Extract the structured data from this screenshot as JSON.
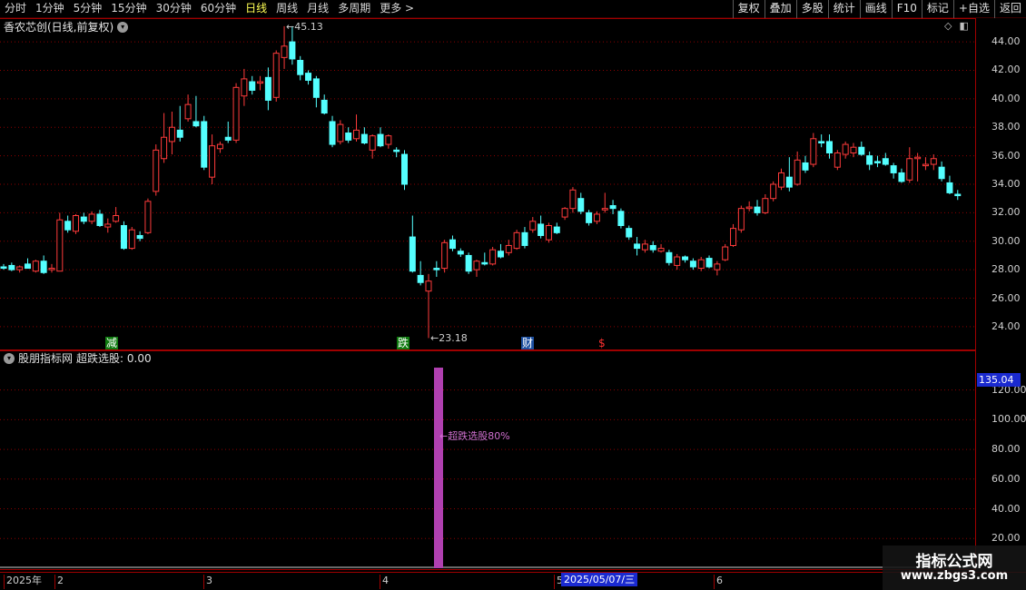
{
  "toolbar": {
    "periods": [
      "分时",
      "1分钟",
      "5分钟",
      "15分钟",
      "30分钟",
      "60分钟",
      "日线",
      "周线",
      "月线",
      "多周期",
      "更多 >"
    ],
    "active_period": "日线",
    "buttons": [
      "复权",
      "叠加",
      "多股",
      "统计",
      "画线",
      "F10",
      "标记",
      "+自选",
      "返回"
    ]
  },
  "main_panel": {
    "title": "香农芯创(日线,前复权)",
    "high_label": "45.13",
    "low_label": "23.18",
    "y_axis_ticks": [
      "44.00",
      "42.00",
      "40.00",
      "38.00",
      "36.00",
      "34.00",
      "32.00",
      "30.00",
      "28.00",
      "26.00",
      "24.00"
    ],
    "markers": [
      {
        "text": "减",
        "color": "#ffffff",
        "bg": "#0f7a0f"
      },
      {
        "text": "跌",
        "color": "#ffffff",
        "bg": "#0f7a0f"
      },
      {
        "text": "财",
        "color": "#ffffff",
        "bg": "#1c4fa0"
      },
      {
        "text": "$",
        "color": "#ff3030",
        "bg": "transparent"
      }
    ]
  },
  "indicator_panel": {
    "title": "股朋指标网",
    "formula_label": "超跌选股: 0.00",
    "bar_label": "超跌选股80%",
    "current_value": "135.04",
    "y_axis_ticks": [
      "120.00",
      "100.00",
      "80.00",
      "60.00",
      "40.00",
      "20.00"
    ],
    "bar_value": 135.04,
    "bar_color": "#b040b0"
  },
  "date_axis": {
    "ticks": [
      "2025年",
      "2",
      "3",
      "4",
      "5",
      "6"
    ],
    "cursor_date": "2025/05/07/三"
  },
  "watermark": {
    "title": "指标公式网",
    "url": "www.zbgs3.com"
  },
  "colors": {
    "up": "#ff3b3b",
    "down": "#54ffff",
    "grid": "#8a0000",
    "frame": "#a00000"
  },
  "chart_data": {
    "type": "candlestick",
    "ylim": [
      22.4,
      45.6
    ],
    "candles": [
      {
        "o": 28.2,
        "h": 28.4,
        "l": 28.0,
        "c": 28.1
      },
      {
        "o": 28.3,
        "h": 28.5,
        "l": 27.9,
        "c": 28.0
      },
      {
        "o": 28.0,
        "h": 28.3,
        "l": 27.8,
        "c": 28.2
      },
      {
        "o": 28.4,
        "h": 28.8,
        "l": 28.2,
        "c": 28.1
      },
      {
        "o": 27.9,
        "h": 28.7,
        "l": 27.8,
        "c": 28.6
      },
      {
        "o": 28.6,
        "h": 29.0,
        "l": 27.7,
        "c": 27.8
      },
      {
        "o": 28.0,
        "h": 28.4,
        "l": 27.8,
        "c": 28.1
      },
      {
        "o": 27.9,
        "h": 32.0,
        "l": 27.9,
        "c": 31.5
      },
      {
        "o": 31.4,
        "h": 31.8,
        "l": 30.6,
        "c": 30.8
      },
      {
        "o": 30.7,
        "h": 31.9,
        "l": 30.5,
        "c": 31.8
      },
      {
        "o": 31.7,
        "h": 32.0,
        "l": 31.2,
        "c": 31.4
      },
      {
        "o": 31.4,
        "h": 32.1,
        "l": 31.2,
        "c": 31.9
      },
      {
        "o": 31.9,
        "h": 32.2,
        "l": 31.0,
        "c": 31.1
      },
      {
        "o": 31.0,
        "h": 31.6,
        "l": 30.6,
        "c": 31.2
      },
      {
        "o": 31.4,
        "h": 32.4,
        "l": 31.3,
        "c": 31.8
      },
      {
        "o": 31.1,
        "h": 31.4,
        "l": 29.4,
        "c": 29.5
      },
      {
        "o": 29.5,
        "h": 31.0,
        "l": 29.4,
        "c": 30.8
      },
      {
        "o": 30.4,
        "h": 30.7,
        "l": 30.0,
        "c": 30.2
      },
      {
        "o": 30.6,
        "h": 33.0,
        "l": 30.5,
        "c": 32.8
      },
      {
        "o": 33.5,
        "h": 36.8,
        "l": 33.2,
        "c": 36.4
      },
      {
        "o": 35.8,
        "h": 39.0,
        "l": 35.5,
        "c": 37.3
      },
      {
        "o": 37.0,
        "h": 39.1,
        "l": 36.1,
        "c": 38.0
      },
      {
        "o": 37.8,
        "h": 39.5,
        "l": 37.0,
        "c": 37.3
      },
      {
        "o": 38.6,
        "h": 40.3,
        "l": 38.4,
        "c": 39.6
      },
      {
        "o": 38.4,
        "h": 40.2,
        "l": 38.0,
        "c": 38.1
      },
      {
        "o": 38.4,
        "h": 38.8,
        "l": 35.0,
        "c": 35.2
      },
      {
        "o": 34.5,
        "h": 37.5,
        "l": 34.0,
        "c": 36.7
      },
      {
        "o": 36.5,
        "h": 37.0,
        "l": 36.2,
        "c": 36.8
      },
      {
        "o": 37.3,
        "h": 38.4,
        "l": 36.9,
        "c": 37.1
      },
      {
        "o": 37.1,
        "h": 41.1,
        "l": 36.9,
        "c": 40.8
      },
      {
        "o": 40.2,
        "h": 42.1,
        "l": 39.5,
        "c": 41.4
      },
      {
        "o": 41.2,
        "h": 41.6,
        "l": 40.3,
        "c": 40.6
      },
      {
        "o": 41.1,
        "h": 41.6,
        "l": 40.6,
        "c": 41.2
      },
      {
        "o": 41.5,
        "h": 42.2,
        "l": 39.2,
        "c": 39.9
      },
      {
        "o": 40.1,
        "h": 43.4,
        "l": 39.8,
        "c": 43.2
      },
      {
        "o": 42.9,
        "h": 45.1,
        "l": 42.1,
        "c": 43.7
      },
      {
        "o": 44.0,
        "h": 45.1,
        "l": 42.4,
        "c": 42.8
      },
      {
        "o": 42.7,
        "h": 43.0,
        "l": 41.3,
        "c": 41.7
      },
      {
        "o": 41.8,
        "h": 42.0,
        "l": 41.0,
        "c": 41.3
      },
      {
        "o": 41.4,
        "h": 41.6,
        "l": 39.4,
        "c": 40.1
      },
      {
        "o": 39.9,
        "h": 40.3,
        "l": 38.9,
        "c": 39.0
      },
      {
        "o": 38.4,
        "h": 38.8,
        "l": 36.6,
        "c": 36.8
      },
      {
        "o": 37.0,
        "h": 38.5,
        "l": 36.8,
        "c": 38.2
      },
      {
        "o": 37.6,
        "h": 38.0,
        "l": 36.9,
        "c": 37.1
      },
      {
        "o": 37.2,
        "h": 38.9,
        "l": 37.0,
        "c": 37.8
      },
      {
        "o": 37.5,
        "h": 38.0,
        "l": 36.8,
        "c": 36.9
      },
      {
        "o": 36.4,
        "h": 37.5,
        "l": 35.8,
        "c": 37.4
      },
      {
        "o": 37.5,
        "h": 38.0,
        "l": 36.6,
        "c": 36.7
      },
      {
        "o": 36.8,
        "h": 37.5,
        "l": 36.5,
        "c": 37.4
      },
      {
        "o": 36.4,
        "h": 36.6,
        "l": 35.9,
        "c": 36.3
      },
      {
        "o": 36.1,
        "h": 36.4,
        "l": 33.6,
        "c": 34.0
      },
      {
        "o": 30.3,
        "h": 31.8,
        "l": 27.8,
        "c": 27.9
      },
      {
        "o": 27.6,
        "h": 28.6,
        "l": 26.9,
        "c": 27.1
      },
      {
        "o": 26.5,
        "h": 27.7,
        "l": 23.2,
        "c": 27.2
      },
      {
        "o": 28.1,
        "h": 28.6,
        "l": 27.5,
        "c": 28.0
      },
      {
        "o": 28.1,
        "h": 30.1,
        "l": 27.8,
        "c": 29.9
      },
      {
        "o": 30.1,
        "h": 30.4,
        "l": 29.3,
        "c": 29.5
      },
      {
        "o": 29.3,
        "h": 29.5,
        "l": 28.9,
        "c": 29.1
      },
      {
        "o": 29.0,
        "h": 29.2,
        "l": 27.7,
        "c": 27.9
      },
      {
        "o": 28.0,
        "h": 28.7,
        "l": 27.5,
        "c": 28.6
      },
      {
        "o": 28.5,
        "h": 29.2,
        "l": 28.3,
        "c": 28.4
      },
      {
        "o": 28.4,
        "h": 29.6,
        "l": 28.3,
        "c": 29.4
      },
      {
        "o": 29.3,
        "h": 29.8,
        "l": 28.8,
        "c": 28.9
      },
      {
        "o": 29.2,
        "h": 30.1,
        "l": 29.0,
        "c": 29.7
      },
      {
        "o": 29.5,
        "h": 30.8,
        "l": 29.4,
        "c": 30.6
      },
      {
        "o": 30.6,
        "h": 31.0,
        "l": 29.5,
        "c": 29.7
      },
      {
        "o": 30.8,
        "h": 31.7,
        "l": 30.6,
        "c": 31.4
      },
      {
        "o": 31.2,
        "h": 31.8,
        "l": 30.2,
        "c": 30.4
      },
      {
        "o": 30.1,
        "h": 31.3,
        "l": 29.9,
        "c": 31.1
      },
      {
        "o": 31.0,
        "h": 31.3,
        "l": 30.5,
        "c": 30.6
      },
      {
        "o": 31.7,
        "h": 32.4,
        "l": 31.5,
        "c": 32.3
      },
      {
        "o": 32.3,
        "h": 33.8,
        "l": 32.0,
        "c": 33.6
      },
      {
        "o": 33.0,
        "h": 33.4,
        "l": 31.9,
        "c": 32.1
      },
      {
        "o": 32.0,
        "h": 32.2,
        "l": 31.1,
        "c": 31.3
      },
      {
        "o": 31.4,
        "h": 32.1,
        "l": 31.2,
        "c": 31.9
      },
      {
        "o": 32.2,
        "h": 33.4,
        "l": 32.0,
        "c": 32.3
      },
      {
        "o": 32.5,
        "h": 32.9,
        "l": 31.9,
        "c": 32.3
      },
      {
        "o": 32.1,
        "h": 32.3,
        "l": 30.9,
        "c": 31.1
      },
      {
        "o": 30.9,
        "h": 31.1,
        "l": 30.1,
        "c": 30.3
      },
      {
        "o": 29.8,
        "h": 30.3,
        "l": 29.0,
        "c": 29.5
      },
      {
        "o": 29.4,
        "h": 30.1,
        "l": 29.2,
        "c": 29.8
      },
      {
        "o": 29.7,
        "h": 30.0,
        "l": 29.2,
        "c": 29.4
      },
      {
        "o": 29.3,
        "h": 29.8,
        "l": 29.2,
        "c": 29.5
      },
      {
        "o": 29.2,
        "h": 29.4,
        "l": 28.3,
        "c": 28.5
      },
      {
        "o": 28.3,
        "h": 29.1,
        "l": 28.0,
        "c": 28.9
      },
      {
        "o": 28.9,
        "h": 29.0,
        "l": 28.5,
        "c": 28.7
      },
      {
        "o": 28.6,
        "h": 28.8,
        "l": 28.0,
        "c": 28.2
      },
      {
        "o": 28.1,
        "h": 28.9,
        "l": 27.9,
        "c": 28.7
      },
      {
        "o": 28.8,
        "h": 29.0,
        "l": 28.1,
        "c": 28.2
      },
      {
        "o": 28.0,
        "h": 28.6,
        "l": 27.6,
        "c": 28.4
      },
      {
        "o": 28.7,
        "h": 29.8,
        "l": 28.6,
        "c": 29.6
      },
      {
        "o": 29.7,
        "h": 31.2,
        "l": 29.6,
        "c": 30.9
      },
      {
        "o": 30.8,
        "h": 32.5,
        "l": 30.6,
        "c": 32.3
      },
      {
        "o": 32.3,
        "h": 32.8,
        "l": 32.1,
        "c": 32.4
      },
      {
        "o": 32.4,
        "h": 32.9,
        "l": 31.8,
        "c": 32.0
      },
      {
        "o": 32.0,
        "h": 33.3,
        "l": 31.9,
        "c": 33.0
      },
      {
        "o": 33.0,
        "h": 34.2,
        "l": 32.8,
        "c": 34.0
      },
      {
        "o": 33.8,
        "h": 35.1,
        "l": 33.6,
        "c": 34.8
      },
      {
        "o": 34.5,
        "h": 35.9,
        "l": 33.5,
        "c": 33.8
      },
      {
        "o": 34.0,
        "h": 36.3,
        "l": 33.9,
        "c": 35.7
      },
      {
        "o": 35.5,
        "h": 36.0,
        "l": 34.8,
        "c": 35.0
      },
      {
        "o": 35.4,
        "h": 37.6,
        "l": 35.2,
        "c": 37.2
      },
      {
        "o": 37.0,
        "h": 37.5,
        "l": 36.6,
        "c": 36.9
      },
      {
        "o": 37.0,
        "h": 37.5,
        "l": 35.8,
        "c": 36.2
      },
      {
        "o": 35.2,
        "h": 36.4,
        "l": 35.0,
        "c": 36.2
      },
      {
        "o": 36.1,
        "h": 37.0,
        "l": 35.8,
        "c": 36.8
      },
      {
        "o": 36.2,
        "h": 36.9,
        "l": 35.9,
        "c": 36.6
      },
      {
        "o": 36.6,
        "h": 37.0,
        "l": 36.0,
        "c": 36.1
      },
      {
        "o": 36.0,
        "h": 36.3,
        "l": 35.0,
        "c": 35.4
      },
      {
        "o": 35.6,
        "h": 36.0,
        "l": 35.2,
        "c": 35.5
      },
      {
        "o": 35.8,
        "h": 36.2,
        "l": 35.3,
        "c": 35.4
      },
      {
        "o": 35.3,
        "h": 35.5,
        "l": 34.4,
        "c": 34.8
      },
      {
        "o": 34.8,
        "h": 35.1,
        "l": 34.1,
        "c": 34.2
      },
      {
        "o": 34.3,
        "h": 36.6,
        "l": 34.1,
        "c": 35.8
      },
      {
        "o": 35.8,
        "h": 36.2,
        "l": 34.2,
        "c": 35.9
      },
      {
        "o": 35.3,
        "h": 35.9,
        "l": 35.0,
        "c": 35.4
      },
      {
        "o": 35.4,
        "h": 36.1,
        "l": 35.0,
        "c": 35.8
      },
      {
        "o": 35.2,
        "h": 35.6,
        "l": 34.2,
        "c": 34.4
      },
      {
        "o": 34.1,
        "h": 34.6,
        "l": 33.3,
        "c": 33.4
      },
      {
        "o": 33.3,
        "h": 33.6,
        "l": 32.9,
        "c": 33.2
      }
    ]
  }
}
